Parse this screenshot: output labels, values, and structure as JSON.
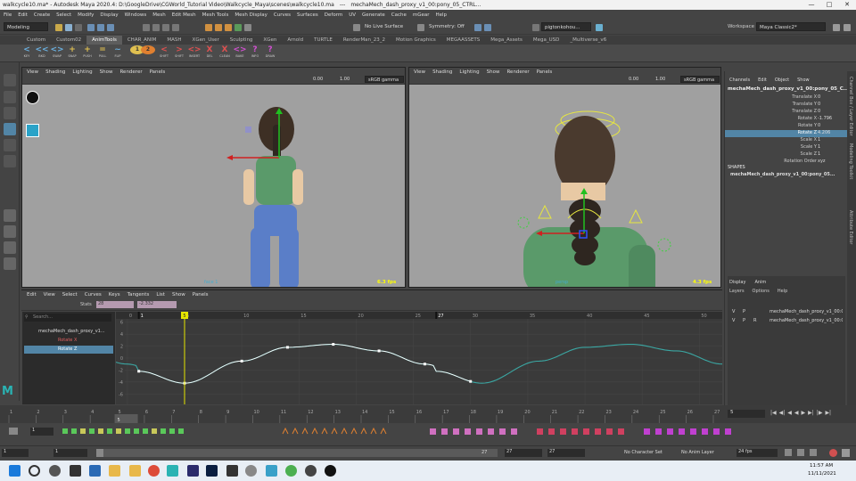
{
  "window": {
    "title_left": "walkcycle10.ma* - Autodesk Maya 2020.4: D:\\GoogleDrive\\CGWorld_Tutorial Video\\Walkcycle_Maya\\scenes\\walkcycle10.ma",
    "title_sep": "---",
    "title_right": "mechaMech_dash_proxy_v1_00:pony_05_CTRL..."
  },
  "menubar": [
    "File",
    "Edit",
    "Create",
    "Select",
    "Modify",
    "Display",
    "Windows",
    "Mesh",
    "Edit Mesh",
    "Mesh Tools",
    "Mesh Display",
    "Curves",
    "Surfaces",
    "Deform",
    "UV",
    "Generate",
    "Cache",
    "mGear",
    "Help"
  ],
  "status": {
    "mode": "Modeling",
    "live_surface": "No Live Surface",
    "symmetry": "Symmetry: Off",
    "user": "pigtonkohou...",
    "workspace_label": "Workspace :",
    "workspace_value": "Maya Classic2*"
  },
  "shelf_tabs": [
    "Custom",
    "Custom02",
    "AnimTools",
    "CHAR_ANIM",
    "MASH",
    "XGen_User",
    "Sculpting",
    "XGen",
    "Arnold",
    "TURTLE",
    "RenderMan_23_2",
    "Motion Graphics",
    "MEGAASSETS",
    "Mega_Assets",
    "Mega_USD",
    "_Multiverse_v6"
  ],
  "active_shelf_tab": "AnimTools",
  "shelf_buttons": [
    {
      "g": "<",
      "l": "KEY"
    },
    {
      "g": "<<",
      "l": "BKD"
    },
    {
      "g": "<>",
      "l": "SWAP"
    },
    {
      "g": "+",
      "l": "SNAP"
    },
    {
      "g": "+",
      "l": "PUSH"
    },
    {
      "g": "=",
      "l": "PULL"
    },
    {
      "g": "~",
      "l": "FLIP"
    },
    {
      "g": "1",
      "l": ""
    },
    {
      "g": "2",
      "l": ""
    },
    {
      "g": "<",
      "l": "SHIFT"
    },
    {
      "g": ">",
      "l": "SHIFT"
    },
    {
      "g": "<>",
      "l": "INSERT"
    },
    {
      "g": "X",
      "l": "DEL"
    },
    {
      "g": "X",
      "l": "CLEAN"
    },
    {
      "g": "<>",
      "l": "BAKE"
    },
    {
      "g": "?",
      "l": "INFO"
    },
    {
      "g": "?",
      "l": "DRAW"
    }
  ],
  "viewport_left": {
    "menu": [
      "View",
      "Shading",
      "Lighting",
      "Show",
      "Renderer",
      "Panels"
    ],
    "num1": "0.00",
    "num2": "1.00",
    "colorspace": "sRGB gamma",
    "camera": "face 1",
    "fps": "6.3 fps"
  },
  "viewport_right": {
    "menu": [
      "View",
      "Shading",
      "Lighting",
      "Show",
      "Renderer",
      "Panels"
    ],
    "num1": "0.00",
    "num2": "1.00",
    "colorspace": "sRGB gamma",
    "camera": "persp",
    "fps": "4.3 fps"
  },
  "channel_box": {
    "menu": [
      "Channels",
      "Edit",
      "Object",
      "Show"
    ],
    "object": "mechaMech_dash_proxy_v1_00:pony_05_C...",
    "channels": [
      {
        "name": "Translate X",
        "value": "0"
      },
      {
        "name": "Translate Y",
        "value": "0"
      },
      {
        "name": "Translate Z",
        "value": "0"
      },
      {
        "name": "Rotate X",
        "value": "-1.796"
      },
      {
        "name": "Rotate Y",
        "value": "0"
      },
      {
        "name": "Rotate Z",
        "value": "4.206"
      },
      {
        "name": "Scale X",
        "value": "1"
      },
      {
        "name": "Scale Y",
        "value": "1"
      },
      {
        "name": "Scale Z",
        "value": "1"
      },
      {
        "name": "Rotation Order",
        "value": "xyz"
      }
    ],
    "shapes_label": "SHAPES",
    "shape_name": "mechaMech_dash_proxy_v1_00:pony_05...",
    "layer_tabs": [
      "Display",
      "Anim"
    ],
    "layer_menu": [
      "Layers",
      "Options",
      "Help"
    ],
    "layers": [
      {
        "v": "V",
        "p": "P",
        "r": "",
        "name": "mechaMech_dash_proxy_v1_00:Ct"
      },
      {
        "v": "V",
        "p": "P",
        "r": "R",
        "name": "mechaMech_dash_proxy_v1_00:Gl"
      }
    ],
    "side_tabs": [
      "Channel Box / Layer Editor",
      "Modeling Toolkit",
      "Attribute Editor"
    ]
  },
  "graph_editor": {
    "menu": [
      "Edit",
      "View",
      "Select",
      "Curves",
      "Keys",
      "Tangents",
      "List",
      "Show",
      "Panels"
    ],
    "stats_label": "Stats",
    "stats_v1": "28",
    "stats_v2": "-2.332",
    "search_placeholder": "Search...",
    "outliner_items": [
      "mechaMech_dash_proxy_v1...",
      "Rotate X",
      "Rotate Z"
    ],
    "frame_ticks": [
      "0",
      "5",
      "10",
      "15",
      "20",
      "25",
      "30",
      "35",
      "40",
      "45",
      "50"
    ],
    "value_ticks": [
      "6",
      "4",
      "2",
      "0",
      "-2",
      "-4",
      "-6"
    ],
    "current_frame_label": "5",
    "marker_start": "1",
    "marker_end": "27"
  },
  "graph_curve": {
    "type": "line",
    "frames": [
      1,
      5,
      10,
      14,
      18,
      22,
      26,
      30
    ],
    "rotate_z_keys": [
      -2.2,
      -4.2,
      -0.5,
      1.8,
      2.3,
      1.2,
      -1.0,
      -3.9
    ]
  },
  "timeline": {
    "ticks": [
      "1",
      "2",
      "3",
      "4",
      "5",
      "6",
      "7",
      "8",
      "9",
      "10",
      "11",
      "12",
      "13",
      "14",
      "15",
      "16",
      "17",
      "18",
      "19",
      "20",
      "21",
      "22",
      "23",
      "24",
      "25",
      "26",
      "27"
    ],
    "current": "5",
    "frame_field": "5"
  },
  "range": {
    "start": "1",
    "start2": "1",
    "range_start": "1",
    "range_end": "27",
    "end1": "27",
    "end2": "27",
    "character_set": "No Character Set",
    "anim_layer": "No Anim Layer",
    "fps": "24 fps"
  },
  "taskbar": {
    "time": "11:57 AM",
    "date": "11/11/2021"
  },
  "colors": {
    "curve_rz": "#3aa7a3",
    "curve_selected": "#ffffff",
    "current_frame": "#e6e600",
    "selection_blue": "#5285a6"
  }
}
